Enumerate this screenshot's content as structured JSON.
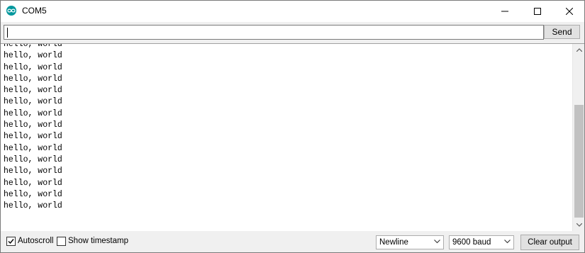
{
  "window": {
    "title": "COM5",
    "icon": "arduino-icon"
  },
  "input": {
    "value": "",
    "placeholder": ""
  },
  "buttons": {
    "send": "Send",
    "clear_output": "Clear output"
  },
  "output": {
    "lines": [
      "hello, world",
      "hello, world",
      "hello, world",
      "hello, world",
      "hello, world",
      "hello, world",
      "hello, world",
      "hello, world",
      "hello, world",
      "hello, world",
      "hello, world",
      "hello, world",
      "hello, world",
      "hello, world",
      "hello, world"
    ]
  },
  "footer": {
    "autoscroll_label": "Autoscroll",
    "autoscroll_checked": true,
    "timestamp_label": "Show timestamp",
    "timestamp_checked": false,
    "line_ending": "Newline",
    "baud_rate": "9600 baud"
  },
  "colors": {
    "accent": "#00979d",
    "window_bg": "#f0f0f0",
    "button_bg": "#e1e1e1"
  }
}
